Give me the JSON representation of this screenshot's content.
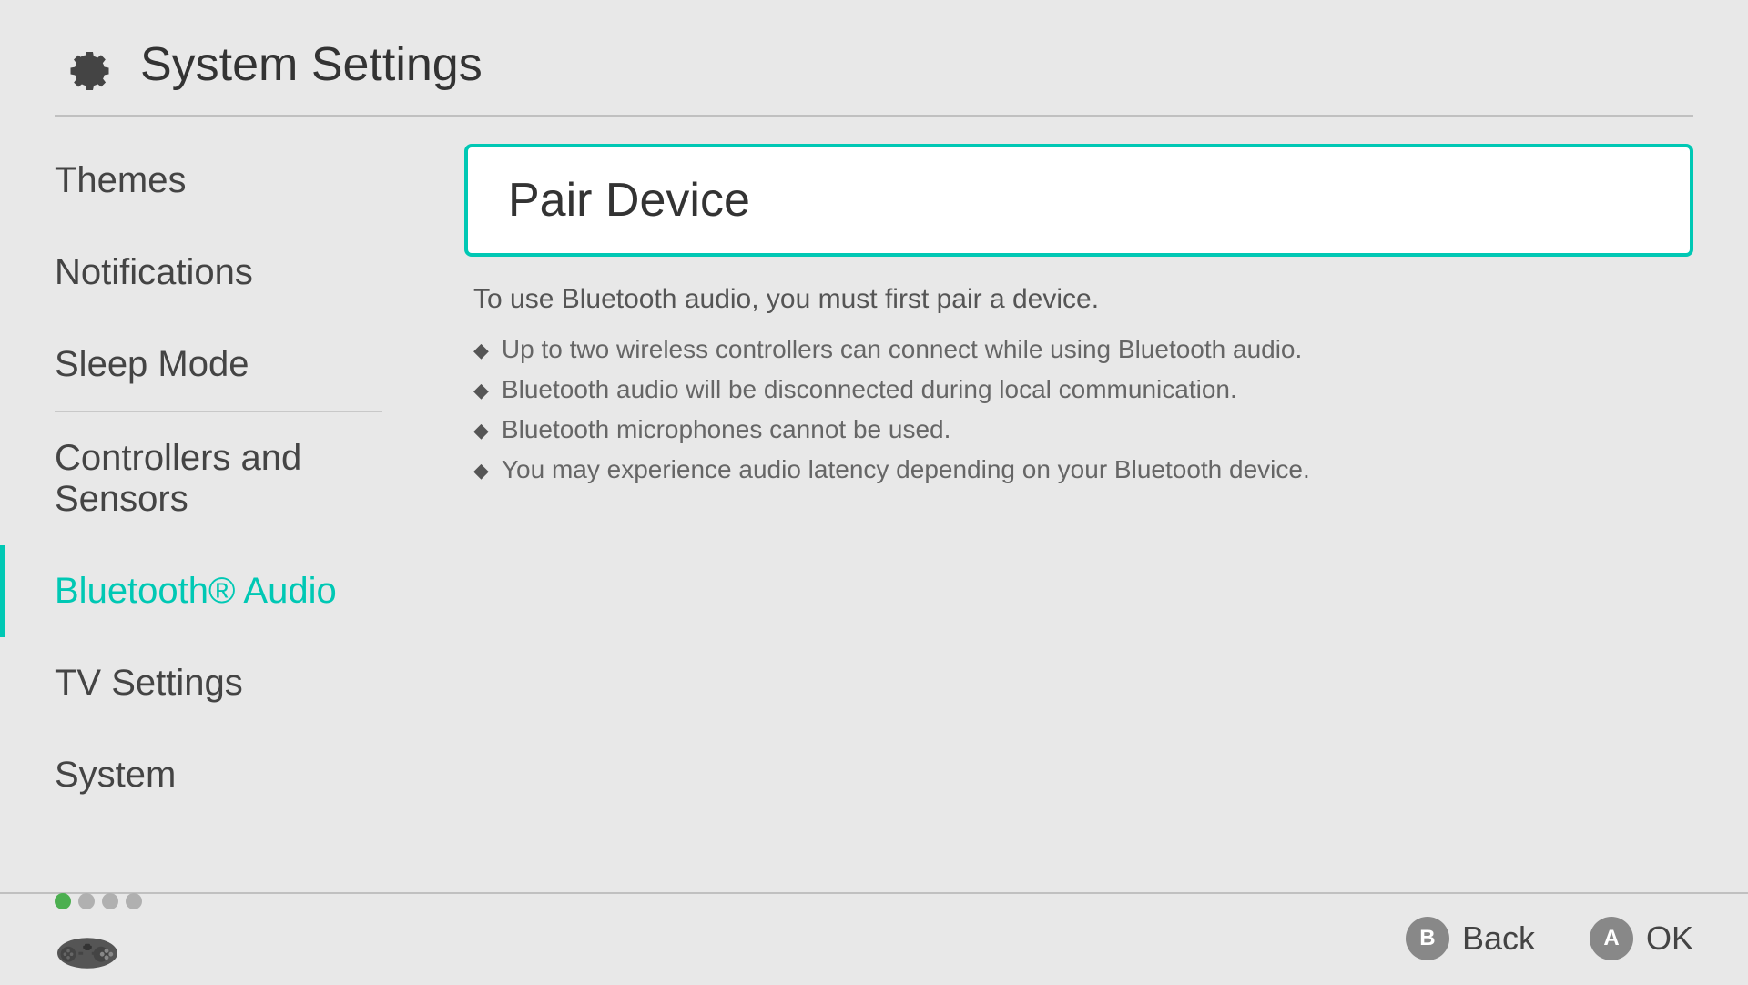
{
  "header": {
    "title": "System Settings",
    "icon": "gear"
  },
  "sidebar": {
    "items": [
      {
        "id": "themes",
        "label": "Themes",
        "active": false,
        "divider_after": false
      },
      {
        "id": "notifications",
        "label": "Notifications",
        "active": false,
        "divider_after": false
      },
      {
        "id": "sleep-mode",
        "label": "Sleep Mode",
        "active": false,
        "divider_after": true
      },
      {
        "id": "controllers-sensors",
        "label": "Controllers and Sensors",
        "active": false,
        "divider_after": false
      },
      {
        "id": "bluetooth-audio",
        "label": "Bluetooth® Audio",
        "active": true,
        "divider_after": false
      },
      {
        "id": "tv-settings",
        "label": "TV Settings",
        "active": false,
        "divider_after": false
      },
      {
        "id": "system",
        "label": "System",
        "active": false,
        "divider_after": false
      }
    ]
  },
  "main": {
    "pair_device": {
      "title": "Pair Device",
      "info_text": "To use Bluetooth audio, you must first pair a device.",
      "bullets": [
        "Up to two wireless controllers can connect while using Bluetooth audio.",
        "Bluetooth audio will be disconnected during local communication.",
        "Bluetooth microphones cannot be used.",
        "You may experience audio latency depending on your Bluetooth device."
      ]
    }
  },
  "footer": {
    "dots": [
      {
        "active": true
      },
      {
        "active": false
      },
      {
        "active": false
      },
      {
        "active": false
      }
    ],
    "buttons": [
      {
        "id": "back",
        "circle_label": "B",
        "label": "Back"
      },
      {
        "id": "ok",
        "circle_label": "A",
        "label": "OK"
      }
    ]
  }
}
